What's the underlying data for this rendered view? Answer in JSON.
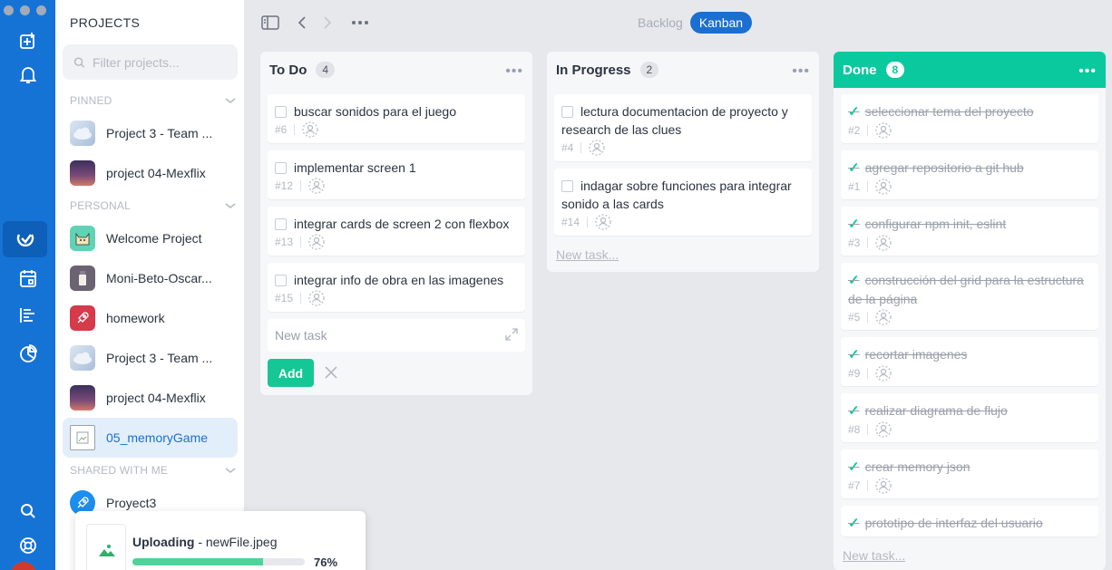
{
  "colors": {
    "rail": "#1673d6",
    "accent": "#1b6fd0",
    "done": "#0ac99f",
    "add_button": "#15c795"
  },
  "sidebar": {
    "title": "PROJECTS",
    "filter_placeholder": "Filter projects...",
    "sections": {
      "pinned": "PINNED",
      "personal": "PERSONAL",
      "shared": "SHARED WITH ME"
    },
    "pinned": [
      {
        "label": "Project 3 - Team ...",
        "thumb": "cloud"
      },
      {
        "label": "project 04-Mexflix",
        "thumb": "sunset"
      }
    ],
    "personal": [
      {
        "label": "Welcome Project",
        "thumb": "cat"
      },
      {
        "label": "Moni-Beto-Oscar...",
        "thumb": "jar"
      },
      {
        "label": "homework",
        "thumb": "rocket"
      },
      {
        "label": "Project 3 - Team ...",
        "thumb": "cloud"
      },
      {
        "label": "project 04-Mexflix",
        "thumb": "sunset"
      },
      {
        "label": "05_memoryGame",
        "thumb": "broken-image",
        "selected": true
      }
    ],
    "shared": [
      {
        "label": "Proyect3",
        "thumb": "rocket"
      }
    ]
  },
  "topbar": {
    "views": {
      "backlog": "Backlog",
      "kanban": "Kanban"
    }
  },
  "board": {
    "todo": {
      "title": "To Do",
      "count": "4",
      "cards": [
        {
          "title": "buscar sonidos para el juego",
          "num": "#6"
        },
        {
          "title": "implementar screen 1",
          "num": "#12"
        },
        {
          "title": "integrar cards de screen 2 con flexbox",
          "num": "#13"
        },
        {
          "title": "integrar info de obra en las imagenes",
          "num": "#15"
        }
      ],
      "new_task_placeholder": "New task",
      "add_label": "Add"
    },
    "in_progress": {
      "title": "In Progress",
      "count": "2",
      "cards": [
        {
          "title": "lectura documentacion de proyecto y research de las clues",
          "num": "#4"
        },
        {
          "title": "indagar sobre funciones para integrar sonido a las cards",
          "num": "#14"
        }
      ],
      "new_task_link": "New task..."
    },
    "done": {
      "title": "Done",
      "count": "8",
      "cards": [
        {
          "title": "seleccionar tema del proyecto",
          "num": "#2"
        },
        {
          "title": "agregar repositorio a git hub",
          "num": "#1"
        },
        {
          "title": "configurar npm init, eslint",
          "num": "#3"
        },
        {
          "title": "construcción del grid para la estructura de la página",
          "num": "#5"
        },
        {
          "title": "recortar imagenes",
          "num": "#9"
        },
        {
          "title": "realizar diagrama de flujo",
          "num": "#8"
        },
        {
          "title": "crear memory json",
          "num": "#7"
        },
        {
          "title": "prototipo de interfaz del usuario",
          "num": ""
        }
      ],
      "new_task_link": "New task..."
    }
  },
  "upload": {
    "label": "Uploading",
    "filename": " - newFile.jpeg",
    "thumb_name": "newFile",
    "progress": 76,
    "progress_text": "76%"
  }
}
